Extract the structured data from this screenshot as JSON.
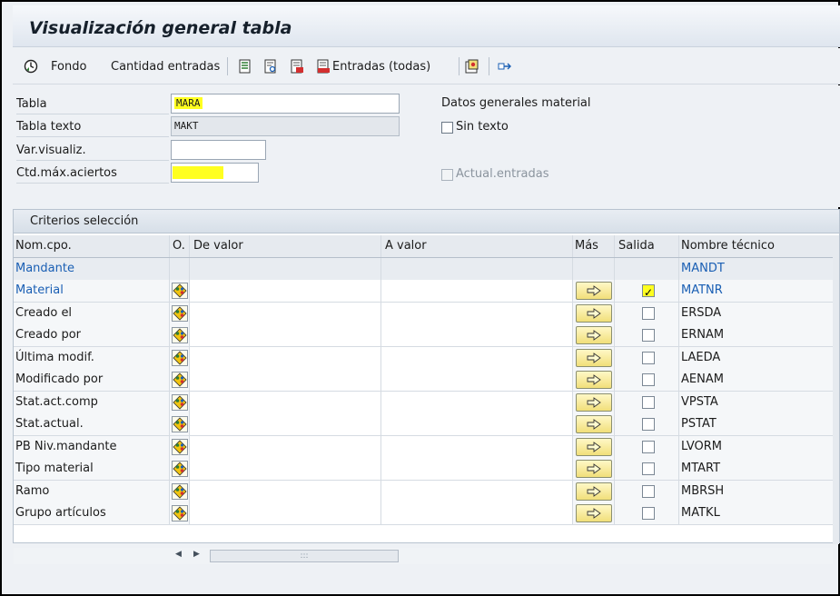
{
  "title": "Visualización general tabla",
  "toolbar": {
    "fondo_label": "Fondo",
    "cantidad_label": "Cantidad entradas",
    "entradas_label": "Entradas (todas)"
  },
  "form": {
    "tabla_label": "Tabla",
    "tabla_value": "MARA",
    "tabla_texto_label": "Tabla texto",
    "tabla_texto_value": "MAKT",
    "var_label": "Var.visualiz.",
    "var_value": "",
    "ctd_label": "Ctd.máx.aciertos",
    "ctd_value": "",
    "desc": "Datos generales material",
    "sin_texto_label": "Sin texto",
    "actual_label": "Actual.entradas"
  },
  "criteria": {
    "title": "Criterios selección",
    "headers": {
      "name": "Nom.cpo.",
      "op": "O.",
      "from": "De valor",
      "to": "A valor",
      "more": "Más",
      "out": "Salida",
      "tech": "Nombre técnico"
    },
    "rows": [
      {
        "name": "Mandante",
        "tech": "MANDT"
      },
      {
        "name": "Material",
        "tech": "MATNR"
      },
      {
        "name": "Creado el",
        "tech": "ERSDA"
      },
      {
        "name": "Creado por",
        "tech": "ERNAM"
      },
      {
        "name": "Última modif.",
        "tech": "LAEDA"
      },
      {
        "name": "Modificado por",
        "tech": "AENAM"
      },
      {
        "name": "Stat.act.comp",
        "tech": "VPSTA"
      },
      {
        "name": "Stat.actual.",
        "tech": "PSTAT"
      },
      {
        "name": "PB Niv.mandante",
        "tech": "LVORM"
      },
      {
        "name": "Tipo material",
        "tech": "MTART"
      },
      {
        "name": "Ramo",
        "tech": "MBRSH"
      },
      {
        "name": "Grupo artículos",
        "tech": "MATKL"
      }
    ],
    "checkmark": "✓",
    "scroll_grip": ":::"
  },
  "colors": {
    "highlight": "#ffff20",
    "key_blue": "#1a5fb4"
  }
}
